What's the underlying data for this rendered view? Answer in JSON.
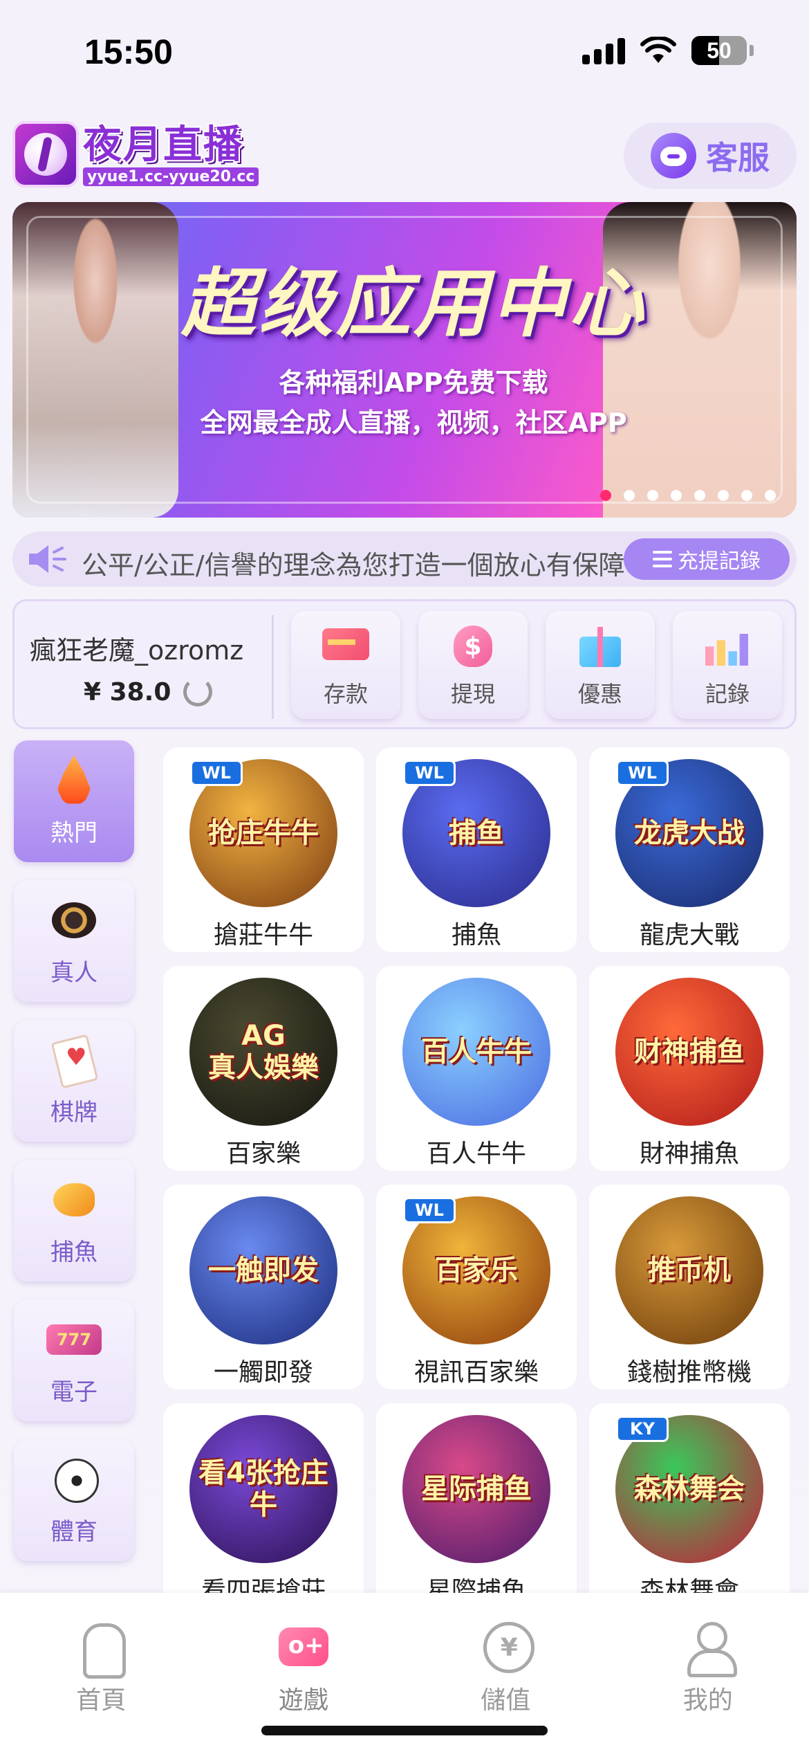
{
  "status_bar": {
    "time": "15:50",
    "battery": "50"
  },
  "header": {
    "logo_title": "夜月直播",
    "logo_subtitle": "yyue1.cc-yyue20.cc",
    "customer_service_label": "客服"
  },
  "banner": {
    "title": "超级应用中心",
    "line1": "各种福利APP免费下载",
    "line2": "全网最全成人直播，视频，社区APP",
    "dot_count": 8,
    "active_dot": 0
  },
  "marquee": {
    "text": "公平/公正/信譽的理念為您打造一個放心有保障",
    "records_label": "充提記錄"
  },
  "user_panel": {
    "username": "瘋狂老魔_ozromz",
    "balance": "¥ 38.0",
    "actions": [
      {
        "label": "存款",
        "icon": "bank-card-icon"
      },
      {
        "label": "提現",
        "icon": "money-bag-icon"
      },
      {
        "label": "優惠",
        "icon": "gift-icon"
      },
      {
        "label": "記錄",
        "icon": "bar-chart-icon"
      }
    ]
  },
  "categories": [
    {
      "label": "熱門",
      "icon": "fire-icon",
      "active": true
    },
    {
      "label": "真人",
      "icon": "chip-icon",
      "active": false
    },
    {
      "label": "棋牌",
      "icon": "playing-card-icon",
      "active": false
    },
    {
      "label": "捕魚",
      "icon": "fish-icon",
      "active": false
    },
    {
      "label": "電子",
      "icon": "slot-machine-icon",
      "active": false
    },
    {
      "label": "體育",
      "icon": "soccer-ball-icon",
      "active": false
    }
  ],
  "games": [
    {
      "name": "搶莊牛牛",
      "art_text": "抢庄牛牛",
      "badge": "WL",
      "colors": [
        "#f2b441",
        "#7a3a12"
      ]
    },
    {
      "name": "捕魚",
      "art_text": "捕鱼",
      "badge": "WL",
      "colors": [
        "#5a6cf0",
        "#2a2a8a"
      ]
    },
    {
      "name": "龍虎大戰",
      "art_text": "龙虎大战",
      "badge": "WL",
      "colors": [
        "#3a6ad8",
        "#1a2a6a"
      ]
    },
    {
      "name": "百家樂",
      "art_text": "AG\n真人娛樂",
      "badge": "",
      "colors": [
        "#4a4a30",
        "#151510"
      ]
    },
    {
      "name": "百人牛牛",
      "art_text": "百人牛牛",
      "badge": "",
      "colors": [
        "#8ad0ff",
        "#4a6ae0"
      ]
    },
    {
      "name": "財神捕魚",
      "art_text": "财神捕鱼",
      "badge": "",
      "colors": [
        "#ff6a3a",
        "#b01a1a"
      ]
    },
    {
      "name": "一觸即發",
      "art_text": "一触即发",
      "badge": "",
      "colors": [
        "#6a8af0",
        "#1a2a7a"
      ]
    },
    {
      "name": "視訊百家樂",
      "art_text": "百家乐",
      "badge": "WL",
      "colors": [
        "#f0b43a",
        "#8a3a0a"
      ]
    },
    {
      "name": "錢樹推幣機",
      "art_text": "推币机",
      "badge": "",
      "colors": [
        "#d89a3a",
        "#6a3a0a"
      ]
    },
    {
      "name": "看四張搶莊",
      "art_text": "看4张抢庄牛",
      "badge": "",
      "colors": [
        "#7a4ad8",
        "#2a1050"
      ]
    },
    {
      "name": "星際捕魚",
      "art_text": "星际捕鱼",
      "badge": "",
      "colors": [
        "#d84a8a",
        "#4a1a6a"
      ]
    },
    {
      "name": "森林舞會",
      "art_text": "森林舞会",
      "badge": "KY",
      "colors": [
        "#3ac85a",
        "#c81a3a"
      ]
    }
  ],
  "bottom_nav": [
    {
      "label": "首頁",
      "icon": "home-icon",
      "active": false
    },
    {
      "label": "遊戲",
      "icon": "gamepad-icon",
      "active": true
    },
    {
      "label": "儲值",
      "icon": "wallet-icon",
      "active": false
    },
    {
      "label": "我的",
      "icon": "user-icon",
      "active": false
    }
  ]
}
